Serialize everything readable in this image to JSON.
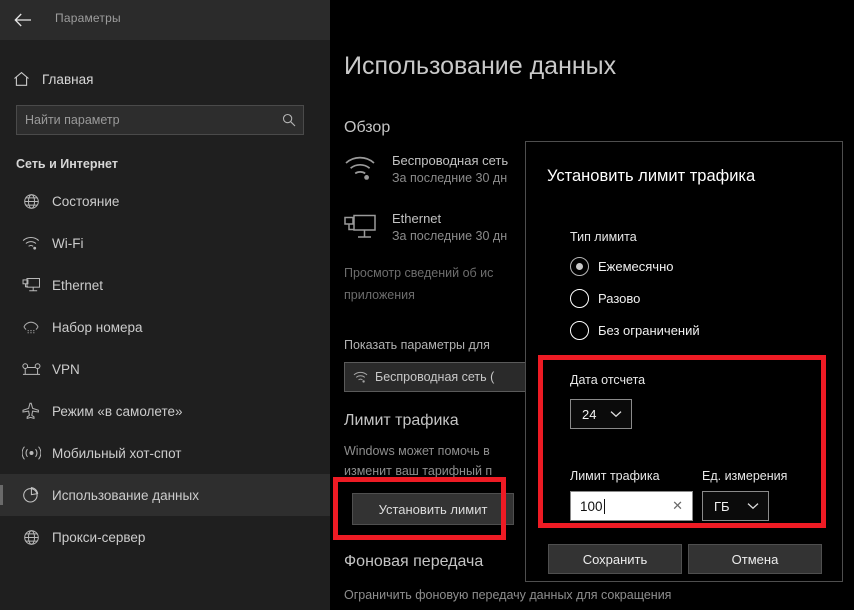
{
  "window": {
    "title": "Параметры",
    "back_icon": "back-arrow-icon"
  },
  "sidebar": {
    "home": {
      "label": "Главная",
      "icon": "home-icon"
    },
    "search": {
      "placeholder": "Найти параметр",
      "value": "",
      "icon": "search-icon"
    },
    "section_header": "Сеть и Интернет",
    "items": [
      {
        "label": "Состояние",
        "icon": "globe-icon",
        "selected": false
      },
      {
        "label": "Wi-Fi",
        "icon": "wifi-icon",
        "selected": false
      },
      {
        "label": "Ethernet",
        "icon": "ethernet-icon",
        "selected": false
      },
      {
        "label": "Набор номера",
        "icon": "dialup-icon",
        "selected": false
      },
      {
        "label": "VPN",
        "icon": "vpn-icon",
        "selected": false
      },
      {
        "label": "Режим «в самолете»",
        "icon": "airplane-icon",
        "selected": false
      },
      {
        "label": "Мобильный хот-спот",
        "icon": "hotspot-icon",
        "selected": false
      },
      {
        "label": "Использование данных",
        "icon": "pie-chart-icon",
        "selected": true
      },
      {
        "label": "Прокси-сервер",
        "icon": "globe-icon",
        "selected": false
      }
    ]
  },
  "main": {
    "page_title": "Использование данных",
    "overview_heading": "Обзор",
    "networks": [
      {
        "name": "Беспроводная сеть",
        "subtitle": "За последние 30 дн",
        "icon": "wifi-icon"
      },
      {
        "name": "Ethernet",
        "subtitle": "За последние 30 дн",
        "icon": "ethernet-icon"
      }
    ],
    "view_details_line1": "Просмотр сведений об ис",
    "view_details_line2": "приложения",
    "show_settings_label": "Показать параметры для",
    "network_selector": {
      "value": "Беспроводная сеть (",
      "icon": "wifi-icon"
    },
    "limit_heading": "Лимит трафика",
    "limit_desc_line1": "Windows может помочь в",
    "limit_desc_line2": "изменит ваш тарифный п",
    "set_limit_button": "Установить лимит",
    "background_heading": "Фоновая передача",
    "background_desc": "Ограничить фоновую передачу данных для сокращения"
  },
  "dialog": {
    "title": "Установить лимит трафика",
    "limit_type_label": "Тип лимита",
    "limit_type_options": [
      {
        "label": "Ежемесячно",
        "selected": true
      },
      {
        "label": "Разово",
        "selected": false
      },
      {
        "label": "Без ограничений",
        "selected": false
      }
    ],
    "reset_date_label": "Дата отсчета",
    "reset_date_value": "24",
    "traffic_limit_label": "Лимит трафика",
    "traffic_limit_value": "100",
    "traffic_limit_clear_icon": "clear-x-icon",
    "unit_label": "Ед. измерения",
    "unit_value": "ГБ",
    "chevron_icon": "chevron-down-icon",
    "save_button": "Сохранить",
    "cancel_button": "Отмена"
  },
  "annotations": {
    "highlight_color": "#ee1b24",
    "boxes": [
      {
        "name": "set-limit-button-highlight"
      },
      {
        "name": "limit-fields-highlight"
      }
    ]
  }
}
